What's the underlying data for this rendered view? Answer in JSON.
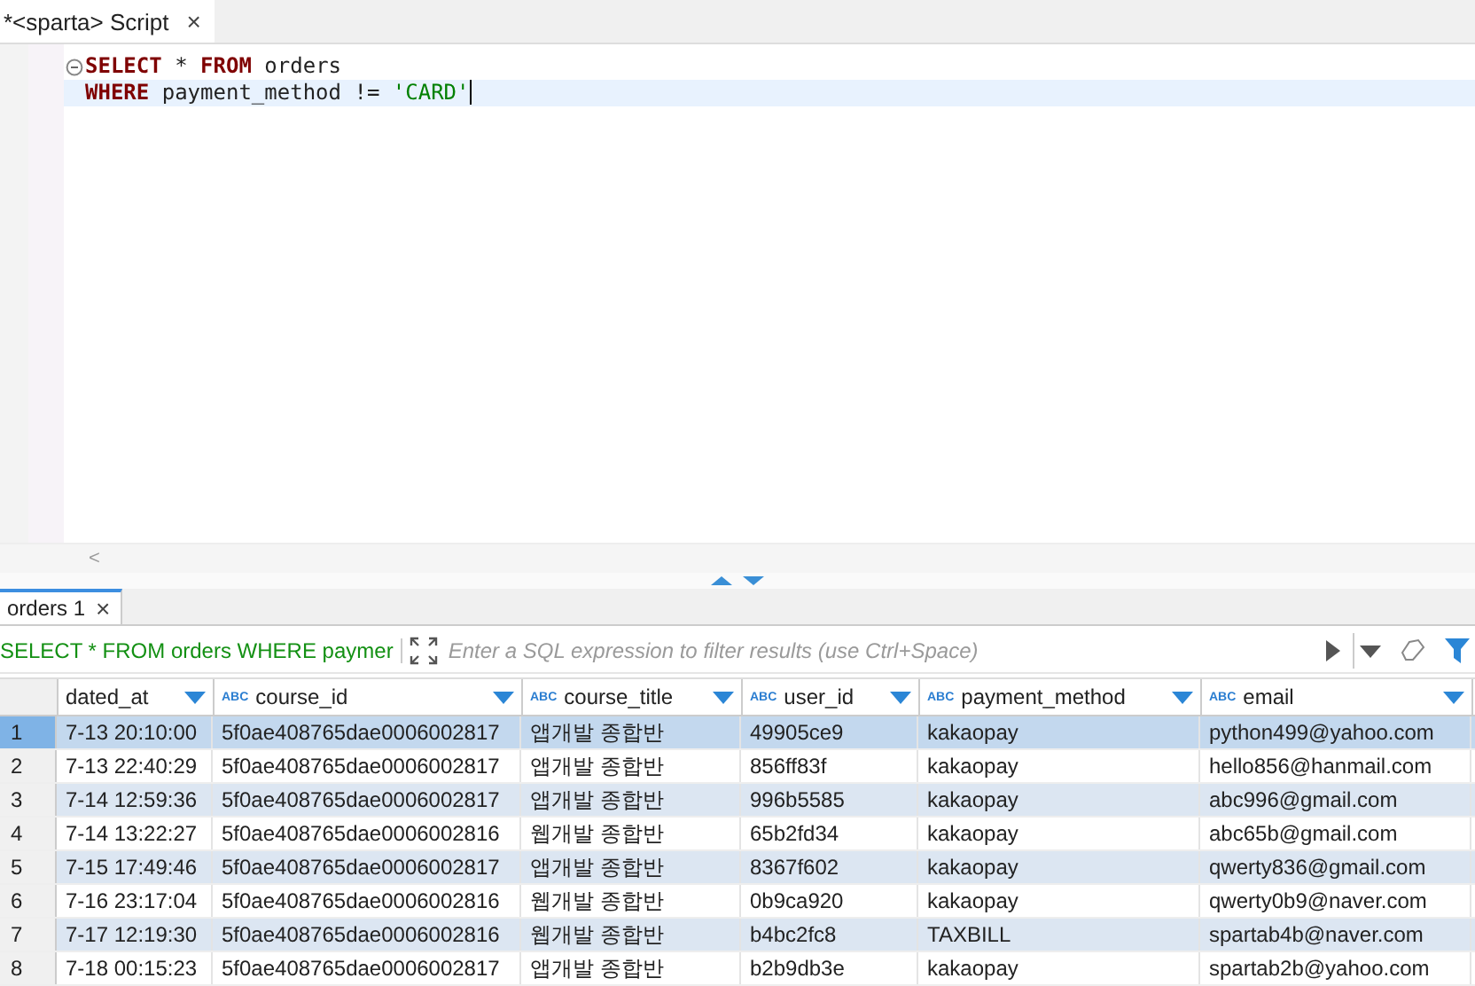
{
  "editor_tab": {
    "title": "*<sparta> Script",
    "close": "×"
  },
  "code_lines": [
    {
      "selected": false,
      "foldable": true,
      "tokens": [
        {
          "kind": "keyword",
          "text": "SELECT"
        },
        {
          "kind": "plain",
          "text": " * "
        },
        {
          "kind": "keyword",
          "text": "FROM"
        },
        {
          "kind": "plain",
          "text": " orders"
        }
      ]
    },
    {
      "selected": true,
      "foldable": false,
      "tokens": [
        {
          "kind": "keyword",
          "text": "WHERE"
        },
        {
          "kind": "plain",
          "text": " payment_method != "
        },
        {
          "kind": "string",
          "text": "'CARD'"
        }
      ]
    }
  ],
  "scroll_left": "<",
  "results_tab": {
    "title": "orders 1",
    "close": "×"
  },
  "filter": {
    "query": "SELECT * FROM orders WHERE paymer",
    "placeholder": "Enter a SQL expression to filter results (use Ctrl+Space)"
  },
  "columns": [
    {
      "name": "dated_at"
    },
    {
      "name": "course_id",
      "type_label": "ABC"
    },
    {
      "name": "course_title",
      "type_label": "ABC"
    },
    {
      "name": "user_id",
      "type_label": "ABC"
    },
    {
      "name": "payment_method",
      "type_label": "ABC"
    },
    {
      "name": "email",
      "type_label": "ABC"
    }
  ],
  "rows": [
    {
      "number": "1",
      "selected": true,
      "cells": [
        "7-13 20:10:00",
        "5f0ae408765dae0006002817",
        "앱개발 종합반",
        "49905ce9",
        "kakaopay",
        "python499@yahoo.com"
      ]
    },
    {
      "number": "2",
      "selected": false,
      "cells": [
        "7-13 22:40:29",
        "5f0ae408765dae0006002817",
        "앱개발 종합반",
        "856ff83f",
        "kakaopay",
        "hello856@hanmail.com"
      ]
    },
    {
      "number": "3",
      "selected": false,
      "cells": [
        "7-14 12:59:36",
        "5f0ae408765dae0006002817",
        "앱개발 종합반",
        "996b5585",
        "kakaopay",
        "abc996@gmail.com"
      ]
    },
    {
      "number": "4",
      "selected": false,
      "cells": [
        "7-14 13:22:27",
        "5f0ae408765dae0006002816",
        "웹개발 종합반",
        "65b2fd34",
        "kakaopay",
        "abc65b@gmail.com"
      ]
    },
    {
      "number": "5",
      "selected": false,
      "cells": [
        "7-15 17:49:46",
        "5f0ae408765dae0006002817",
        "앱개발 종합반",
        "8367f602",
        "kakaopay",
        "qwerty836@gmail.com"
      ]
    },
    {
      "number": "6",
      "selected": false,
      "cells": [
        "7-16 23:17:04",
        "5f0ae408765dae0006002816",
        "웹개발 종합반",
        "0b9ca920",
        "kakaopay",
        "qwerty0b9@naver.com"
      ]
    },
    {
      "number": "7",
      "selected": false,
      "cells": [
        "7-17 12:19:30",
        "5f0ae408765dae0006002816",
        "웹개발 종합반",
        "b4bc2fc8",
        "TAXBILL",
        "spartab4b@naver.com"
      ]
    },
    {
      "number": "8",
      "selected": false,
      "cells": [
        "7-18 00:15:23",
        "5f0ae408765dae0006002817",
        "앱개발 종합반",
        "b2b9db3e",
        "kakaopay",
        "spartab2b@yahoo.com"
      ]
    }
  ]
}
